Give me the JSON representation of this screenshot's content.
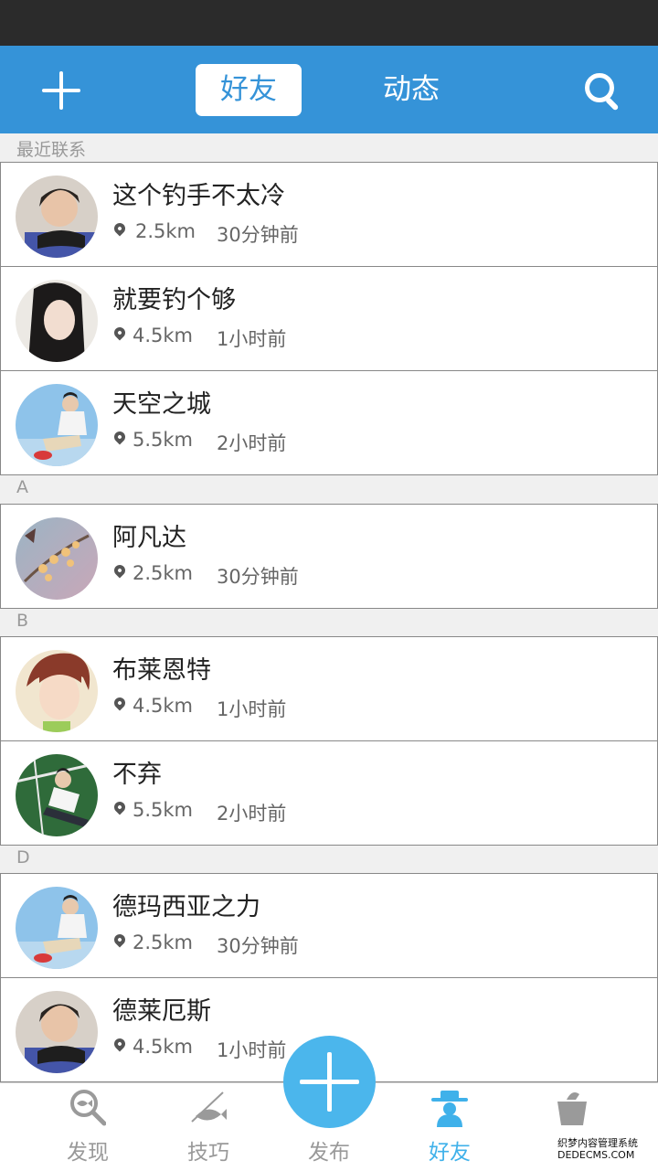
{
  "header": {
    "tab_friends": "好友",
    "tab_moments": "动态"
  },
  "sections": {
    "recent": "最近联系",
    "a": "A",
    "b": "B",
    "d": "D"
  },
  "contacts": [
    {
      "name": "这个钓手不太冷",
      "distance": "2.5km",
      "time": "30分钟前"
    },
    {
      "name": "就要钓个够",
      "distance": "4.5km",
      "time": "1小时前"
    },
    {
      "name": "天空之城",
      "distance": "5.5km",
      "time": "2小时前"
    },
    {
      "name": "阿凡达",
      "distance": "2.5km",
      "time": "30分钟前"
    },
    {
      "name": "布莱恩特",
      "distance": "4.5km",
      "time": "1小时前"
    },
    {
      "name": "不弃",
      "distance": "5.5km",
      "time": "2小时前"
    },
    {
      "name": "德玛西亚之力",
      "distance": "2.5km",
      "time": "30分钟前"
    },
    {
      "name": "德莱厄斯",
      "distance": "4.5km",
      "time": "1小时前"
    }
  ],
  "tabbar": {
    "discover": "发现",
    "skills": "技巧",
    "publish": "发布",
    "friends": "好友",
    "active_color": "#3fb1ea"
  },
  "icons": {
    "add": "plus-icon",
    "search": "search-icon",
    "location": "location-pin-icon"
  },
  "colors": {
    "brand": "#3593d8",
    "status_bar": "#2b2b2b"
  },
  "watermark": {
    "line1": "织梦内容管理系统",
    "line2": "DEDECMS.COM"
  }
}
